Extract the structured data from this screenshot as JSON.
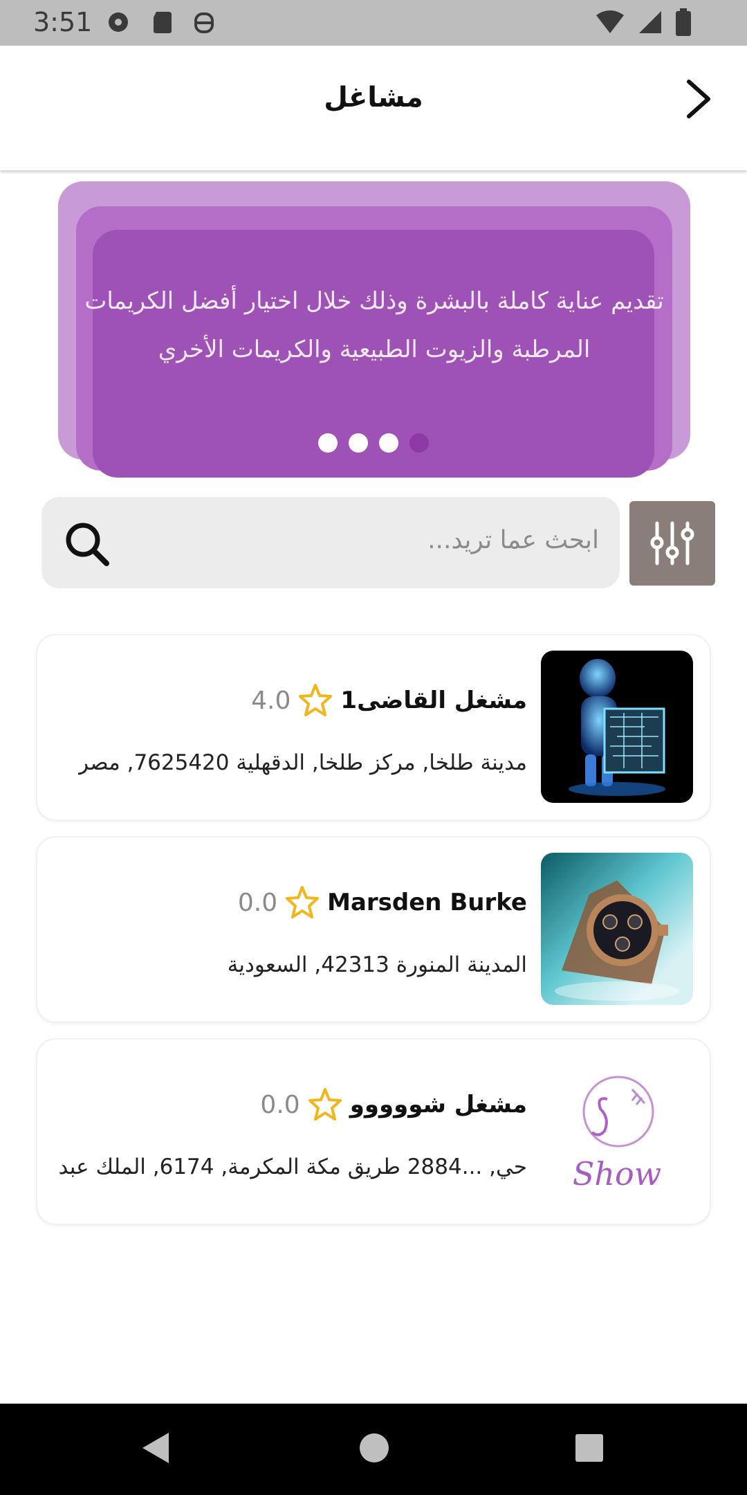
{
  "status_bar": {
    "time": "3:51",
    "icons_left": [
      "media-icon",
      "sd-card-icon",
      "accessibility-icon"
    ],
    "icons_right": [
      "wifi-icon",
      "signal-icon",
      "battery-icon"
    ]
  },
  "app_bar": {
    "title": "مشاغل",
    "back_icon": "chevron-right-icon"
  },
  "banner": {
    "text": "تقديم عناية كاملة بالبشرة وذلك  خلال اختيار أفضل الكريمات المرطبة والزيوت الطبيعية والكريمات الأخري",
    "page_count": 4,
    "active_page": 4,
    "colors": {
      "layer1": "#c89ad6",
      "layer2": "#b56ec8",
      "layer3": "#9f52b6",
      "active_dot": "#8e3aa6"
    }
  },
  "search": {
    "placeholder": "ابحث عما تريد...",
    "search_icon": "search-icon",
    "filter_icon": "sliders-icon"
  },
  "workshops": [
    {
      "name": "مشغل القاضى1",
      "rating": "4.0",
      "address": "مدينة طلخا, مركز طلخا, الدقهلية 7625420, مصر",
      "image": "robot-circuit-image"
    },
    {
      "name": "Marsden Burke",
      "rating": "0.0",
      "address": "المدينة المنورة 42313, السعودية",
      "image": "watch-image"
    },
    {
      "name": "مشغل شووووو",
      "rating": "0.0",
      "address": "حي, ...2884 طريق مكة المكرمة, 6174, الملك عبد",
      "image": "show-logo-image",
      "logo_text": "Show"
    }
  ],
  "nav_bar": {
    "buttons": [
      "back-triangle-icon",
      "home-circle-icon",
      "recents-square-icon"
    ]
  }
}
